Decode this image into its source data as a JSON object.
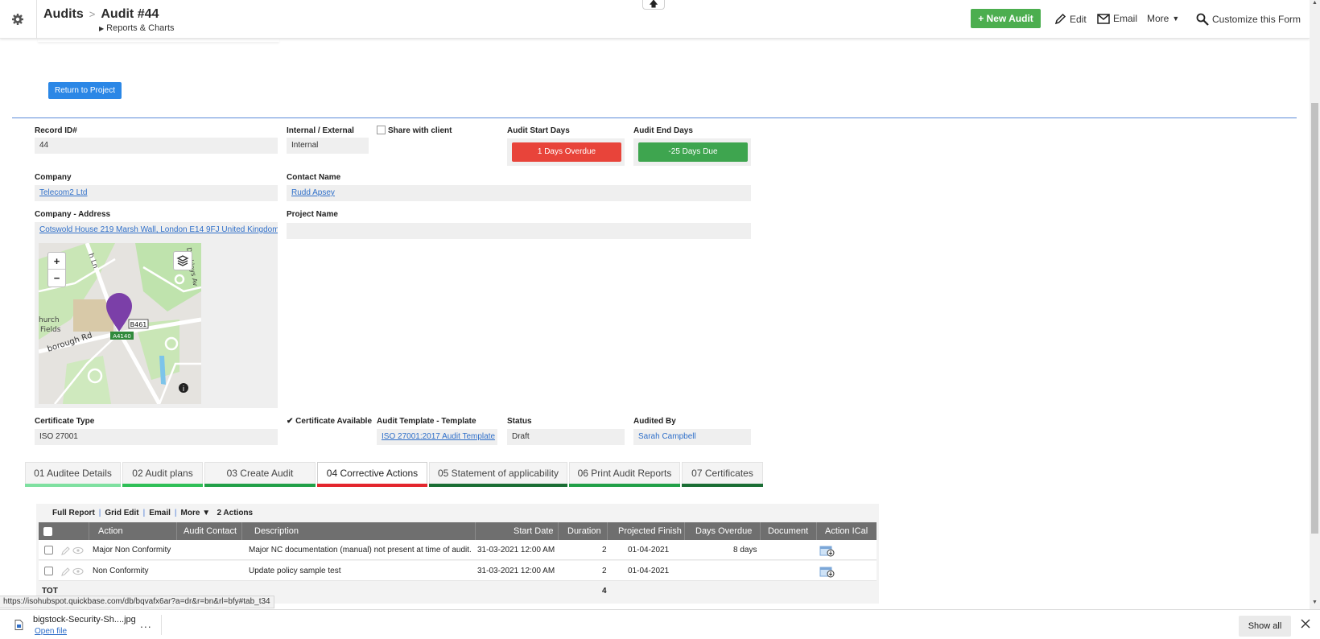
{
  "header": {
    "breadcrumb_root": "Audits",
    "breadcrumb_separator": ">",
    "breadcrumb_current": "Audit #44",
    "sub_breadcrumb": "Reports & Charts",
    "new_audit_label": "+ New Audit",
    "edit_label": "Edit",
    "email_label": "Email",
    "more_label": "More",
    "customize_label": "Customize this Form"
  },
  "return_button_label": "Return to Project",
  "fields": {
    "record_id_label": "Record ID#",
    "record_id_value": "44",
    "internal_external_label": "Internal / External",
    "internal_external_value": "Internal",
    "share_with_client_label": "Share with client",
    "audit_start_days_label": "Audit Start Days",
    "audit_start_days_value": "1 Days Overdue",
    "audit_end_days_label": "Audit End Days",
    "audit_end_days_value": "-25 Days Due",
    "company_label": "Company",
    "company_value": "Telecom2 Ltd",
    "contact_name_label": "Contact Name",
    "contact_name_value": "Rudd Apsey",
    "company_address_label": "Company - Address",
    "company_address_value": "Cotswold House 219 Marsh Wall, London E14 9FJ United Kingdom",
    "project_name_label": "Project Name",
    "project_name_value": "",
    "certificate_type_label": "Certificate Type",
    "certificate_type_value": "ISO 27001",
    "certificate_available_label": "Certificate Available",
    "audit_template_label": "Audit Template - Template",
    "audit_template_value": "ISO 27001:2017 Audit Template",
    "status_label": "Status",
    "status_value": "Draft",
    "audited_by_label": "Audited By",
    "audited_by_value": "Sarah Campbell"
  },
  "map": {
    "zoom_in": "+",
    "zoom_out": "−",
    "road_badge_1": "B461",
    "road_badge_2": "A4140",
    "label_church": "hurch",
    "label_fields": "Fields",
    "label_road": "borough Rd",
    "label_street_top": "h Ln",
    "label_street_right": "Dockleys Av",
    "info_glyph": "i"
  },
  "tabs": [
    {
      "label": "01 Auditee Details",
      "bar_color": "#7ee0a0"
    },
    {
      "label": "02 Audit plans",
      "bar_color": "#2fbf57"
    },
    {
      "label": "03 Create Audit",
      "bar_color": "#22a048"
    },
    {
      "label": "04 Corrective Actions",
      "bar_color": "#e3262d"
    },
    {
      "label": "05 Statement of applicability",
      "bar_color": "#1a6e34"
    },
    {
      "label": "06 Print Audit Reports",
      "bar_color": "#22a048"
    },
    {
      "label": "07 Certificates",
      "bar_color": "#1a6e34"
    }
  ],
  "active_tab": "04 Corrective Actions",
  "report": {
    "links": [
      "Full Report",
      "Grid Edit",
      "Email",
      "More ▼",
      "2 Actions"
    ],
    "columns": [
      "Action",
      "Audit Contact",
      "Description",
      "Start Date",
      "Duration",
      "Projected Finish",
      "Days Overdue",
      "Document",
      "Action ICal"
    ],
    "rows": [
      {
        "action": "Major Non Conformity",
        "audit_contact": "",
        "description": "Major NC documentation (manual) not present at time of audit.",
        "start_date": "31-03-2021 12:00 AM",
        "duration": "2",
        "projected_finish": "01-04-2021",
        "days_overdue": "8 days",
        "document": ""
      },
      {
        "action": "Non Conformity",
        "audit_contact": "",
        "description": "Update policy sample test",
        "start_date": "31-03-2021 12:00 AM",
        "duration": "2",
        "projected_finish": "01-04-2021",
        "days_overdue": "",
        "document": ""
      }
    ],
    "total_label": "TOT",
    "total_duration": "4"
  },
  "status_bar_url": "https://isohubspot.quickbase.com/db/bqvafx6ar?a=dr&r=bn&rl=bfy#tab_t34",
  "downloads": {
    "file_name": "bigstock-Security-Sh....jpg",
    "open_file_label": "Open file",
    "more_glyph": "...",
    "show_all_label": "Show all"
  },
  "colors": {
    "overdue_red": "#e8443a",
    "due_green": "#3ea54f",
    "new_audit_green": "#4cae4f",
    "return_blue": "#2b87e6",
    "grid_header_gray": "#6f6f6f"
  }
}
